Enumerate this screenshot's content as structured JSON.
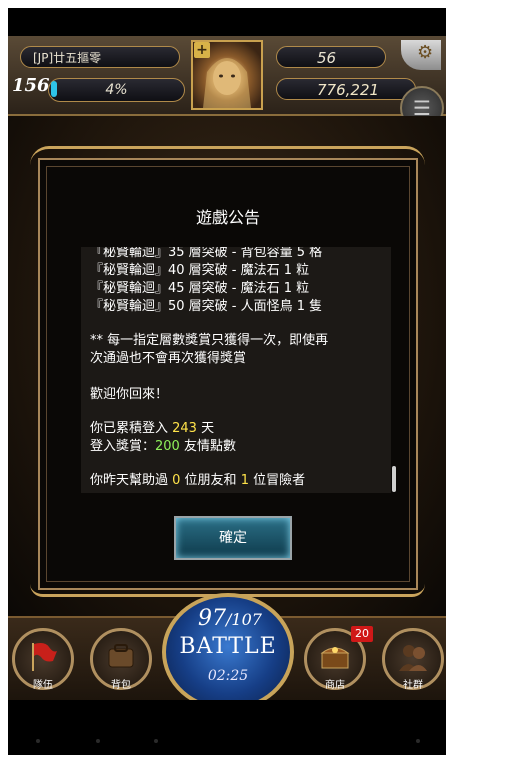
{
  "header": {
    "player_name": "[JP]廿五摳零",
    "level": "156",
    "exp_percent": "4%",
    "gems": "56",
    "coins": "776,221"
  },
  "dialog": {
    "title": "遊戲公告",
    "lines": [
      "『秘賢輪迴』35 層突破 - 背包容量 5 格",
      "『秘賢輪迴』40 層突破 - 魔法石 1 粒",
      "『秘賢輪迴』45 層突破 - 魔法石 1 粒",
      "『秘賢輪迴』50 層突破 - 人面怪鳥 1 隻"
    ],
    "notice_line1": "** 每一指定層數獎賞只獲得一次，即使再",
    "notice_line2": "次通過也不會再次獲得獎賞",
    "welcome": "歡迎你回來！",
    "login_prefix": "你已累積登入 ",
    "login_days": "243",
    "login_suffix": " 天",
    "reward_prefix": "登入獎賞：",
    "reward_amount": "200",
    "reward_suffix": " 友情點數",
    "help_prefix": "你昨天幫助過 ",
    "help_friends": "0",
    "help_mid": " 位朋友和 ",
    "help_adventurers": "1",
    "help_suffix": " 位冒險者",
    "confirm_label": "確定"
  },
  "bottom": {
    "team_label": "隊伍",
    "bag_label": "背包",
    "battle_count": "97",
    "battle_max": "/107",
    "battle_label": "BATTLE",
    "battle_timer": "02:25",
    "shop_label": "商店",
    "shop_badge": "20",
    "social_label": "社群"
  },
  "colors": {
    "highlight_yellow": "#ffe34a",
    "highlight_green": "#8ff05a",
    "gold_frame": "#caa45c"
  }
}
